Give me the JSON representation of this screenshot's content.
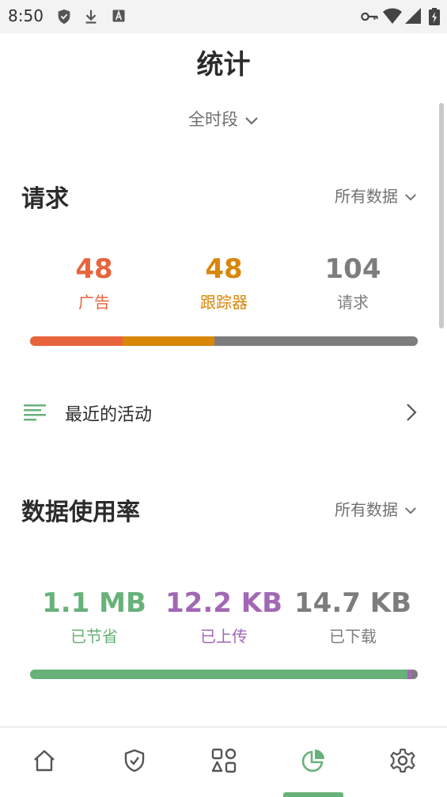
{
  "status_bar": {
    "time": "8:50",
    "left_icons": [
      "shield-icon",
      "download-icon",
      "a-box-icon"
    ],
    "right_icons": [
      "key-icon",
      "wifi-icon",
      "signal-icon",
      "battery-icon"
    ]
  },
  "page": {
    "title": "统计",
    "period_label": "全时段"
  },
  "requests": {
    "title": "请求",
    "filter_label": "所有数据",
    "stats": [
      {
        "value": "48",
        "label": "广告",
        "color": "#e8643c"
      },
      {
        "value": "48",
        "label": "跟踪器",
        "color": "#d98609"
      },
      {
        "value": "104",
        "label": "请求",
        "color": "#7d7d7d"
      }
    ],
    "bar": [
      {
        "name": "ads",
        "fraction": 0.2378,
        "color": "#e8643c"
      },
      {
        "name": "trackers",
        "fraction": 0.2378,
        "color": "#d98609"
      },
      {
        "name": "other",
        "fraction": 0.5244,
        "color": "#7d7d7d"
      }
    ]
  },
  "activity": {
    "label": "最近的活动",
    "icon": "list-lines-icon",
    "arrow": "chevron-right-icon"
  },
  "data_usage": {
    "title": "数据使用率",
    "filter_label": "所有数据",
    "stats": [
      {
        "value": "1.1 MB",
        "label": "已节省",
        "color": "#67b279"
      },
      {
        "value": "12.2 KB",
        "label": "已上传",
        "color": "#a268b5"
      },
      {
        "value": "14.7 KB",
        "label": "已下载",
        "color": "#7d7d7d"
      }
    ],
    "bar": [
      {
        "name": "saved",
        "fraction": 0.974,
        "color": "#67b279"
      },
      {
        "name": "uploaded",
        "fraction": 0.012,
        "color": "#a268b5"
      },
      {
        "name": "downloaded",
        "fraction": 0.014,
        "color": "#7d7d7d"
      }
    ]
  },
  "bottom_nav": {
    "items": [
      "home-icon",
      "protection-shield-icon",
      "activity-shapes-icon",
      "statistics-pie-icon",
      "settings-gear-icon"
    ],
    "active_index": 3,
    "accent": "#67b279"
  }
}
